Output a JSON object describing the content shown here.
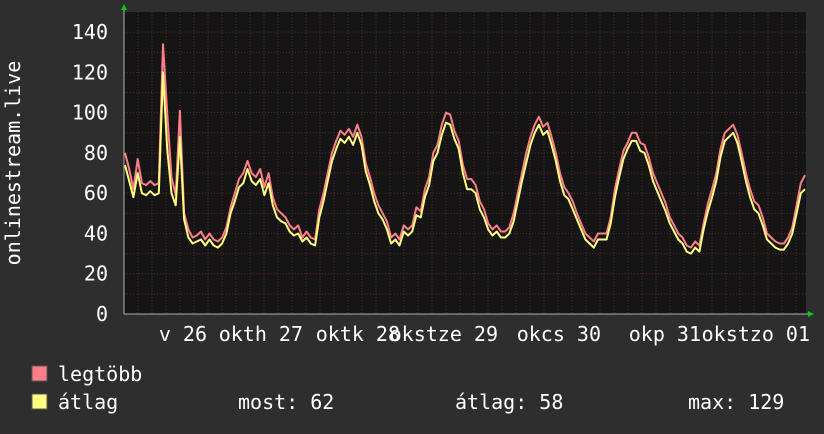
{
  "chart_data": {
    "type": "line",
    "ylabel": "onlinestream.live",
    "ylim": [
      0,
      150
    ],
    "y_ticks": [
      0,
      20,
      40,
      60,
      80,
      100,
      120,
      140
    ],
    "x_tick_labels": [
      "v 26",
      "okth 27",
      "oktk 28",
      "okstze 29",
      "okcs 30",
      "okp 31",
      "okstzo 01"
    ],
    "grid": true,
    "colors": {
      "background": "#2e2e2e",
      "plot_bg": "#151515",
      "grid": "#5a2525",
      "legtobb": "#ff7f88",
      "atlag": "#ffff80",
      "axis": "#b0b0b0",
      "arrow": "#00cc00"
    },
    "series": [
      {
        "name": "legtöbb",
        "values": [
          80,
          72,
          62,
          77,
          65,
          64,
          66,
          64,
          65,
          134,
          100,
          68,
          59,
          101,
          50,
          42,
          38,
          39,
          41,
          37,
          40,
          37,
          36,
          38,
          43,
          53,
          60,
          67,
          70,
          76,
          70,
          68,
          72,
          63,
          70,
          58,
          52,
          50,
          48,
          44,
          42,
          44,
          38,
          41,
          38,
          37,
          52,
          60,
          70,
          80,
          86,
          91,
          89,
          92,
          88,
          94,
          88,
          75,
          68,
          60,
          54,
          50,
          46,
          38,
          40,
          37,
          44,
          42,
          44,
          53,
          51,
          62,
          68,
          80,
          84,
          94,
          100,
          99,
          91,
          86,
          74,
          67,
          67,
          64,
          56,
          52,
          45,
          42,
          44,
          41,
          41,
          43,
          50,
          60,
          70,
          80,
          88,
          94,
          98,
          93,
          95,
          88,
          80,
          70,
          63,
          60,
          56,
          50,
          45,
          40,
          38,
          36,
          40,
          40,
          40,
          48,
          62,
          72,
          81,
          85,
          90,
          90,
          85,
          84,
          78,
          70,
          65,
          60,
          55,
          48,
          44,
          40,
          38,
          34,
          33,
          36,
          34,
          45,
          55,
          62,
          70,
          82,
          90,
          92,
          94,
          89,
          80,
          70,
          62,
          56,
          54,
          48,
          40,
          38,
          36,
          35,
          35,
          38,
          43,
          54,
          65,
          69
        ],
        "values_last": 69
      },
      {
        "name": "átlag",
        "values": [
          74,
          66,
          58,
          70,
          60,
          59,
          61,
          59,
          60,
          120,
          82,
          60,
          54,
          88,
          47,
          38,
          35,
          36,
          37,
          34,
          37,
          34,
          33,
          35,
          40,
          50,
          56,
          63,
          65,
          72,
          66,
          64,
          67,
          59,
          65,
          54,
          48,
          46,
          45,
          41,
          39,
          40,
          36,
          38,
          35,
          34,
          48,
          56,
          66,
          76,
          82,
          87,
          85,
          88,
          84,
          90,
          84,
          71,
          64,
          56,
          50,
          47,
          42,
          35,
          37,
          34,
          41,
          39,
          41,
          49,
          48,
          58,
          64,
          76,
          80,
          89,
          95,
          94,
          87,
          82,
          70,
          62,
          62,
          60,
          52,
          48,
          42,
          39,
          41,
          38,
          38,
          40,
          46,
          56,
          66,
          75,
          84,
          90,
          94,
          89,
          91,
          84,
          76,
          66,
          59,
          57,
          52,
          47,
          42,
          37,
          35,
          33,
          37,
          37,
          37,
          45,
          58,
          68,
          77,
          82,
          86,
          86,
          81,
          80,
          74,
          66,
          61,
          56,
          51,
          45,
          41,
          37,
          35,
          31,
          30,
          33,
          31,
          42,
          51,
          58,
          66,
          78,
          86,
          88,
          90,
          85,
          76,
          66,
          58,
          52,
          50,
          44,
          37,
          35,
          33,
          32,
          32,
          35,
          40,
          50,
          60,
          62
        ]
      }
    ],
    "legend": {
      "items": [
        {
          "label": "legtöbb",
          "color": "#ff7f88"
        },
        {
          "label": "átlag",
          "color": "#ffff80"
        }
      ],
      "stats": {
        "most": "most: 62",
        "atlag": "átlag: 58",
        "max": "max: 129"
      }
    }
  }
}
